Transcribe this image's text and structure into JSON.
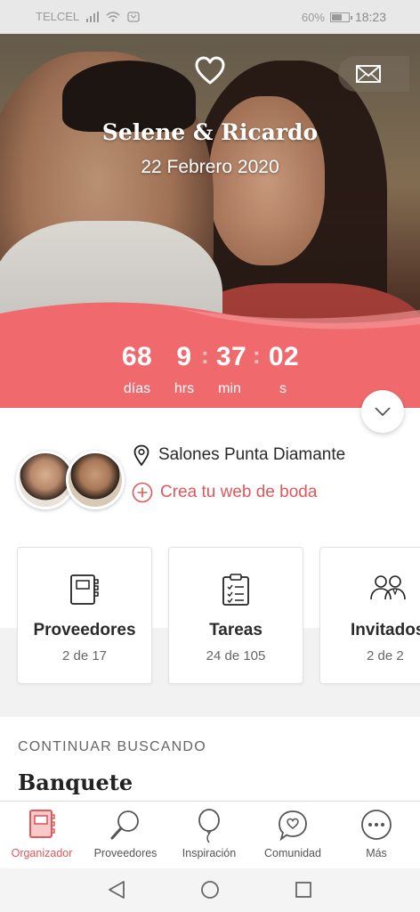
{
  "status_bar": {
    "carrier": "TELCEL",
    "battery": "60%",
    "battery_level": 0.6,
    "time": "18:23"
  },
  "hero": {
    "couple_names": "Selene & Ricardo",
    "wedding_date": "22 Febrero 2020",
    "heart_icon": "heart-outline-icon",
    "mail_icon": "envelope-icon",
    "accent_color": "#f06a6d"
  },
  "countdown": {
    "days": "68",
    "days_label": "días",
    "hours": "9",
    "hours_label": "hrs",
    "minutes": "37",
    "minutes_label": "min",
    "seconds": "02",
    "seconds_label": "s",
    "separator": ":"
  },
  "info": {
    "venue_icon": "location-pin-icon",
    "venue": "Salones Punta Diamante",
    "create_web_icon": "plus-circle-icon",
    "create_web": "Crea tu web de boda",
    "link_color": "#e0585a"
  },
  "cards": [
    {
      "icon": "notebook-icon",
      "title": "Proveedores",
      "subtitle": "2 de 17"
    },
    {
      "icon": "clipboard-checklist-icon",
      "title": "Tareas",
      "subtitle": "24 de 105"
    },
    {
      "icon": "guests-icon",
      "title": "Invitados",
      "subtitle": "2 de 2"
    }
  ],
  "continue_searching": {
    "title": "CONTINUAR BUSCANDO",
    "item": "Banquete"
  },
  "bottom_nav": [
    {
      "icon": "organizer-notebook-icon",
      "label": "Organizador",
      "active": true
    },
    {
      "icon": "magnifier-icon",
      "label": "Proveedores",
      "active": false
    },
    {
      "icon": "balloon-icon",
      "label": "Inspiración",
      "active": false
    },
    {
      "icon": "chat-heart-icon",
      "label": "Comunidad",
      "active": false
    },
    {
      "icon": "more-dots-icon",
      "label": "Más",
      "active": false
    }
  ],
  "system_nav": [
    "back-triangle-icon",
    "home-circle-icon",
    "recents-square-icon"
  ]
}
